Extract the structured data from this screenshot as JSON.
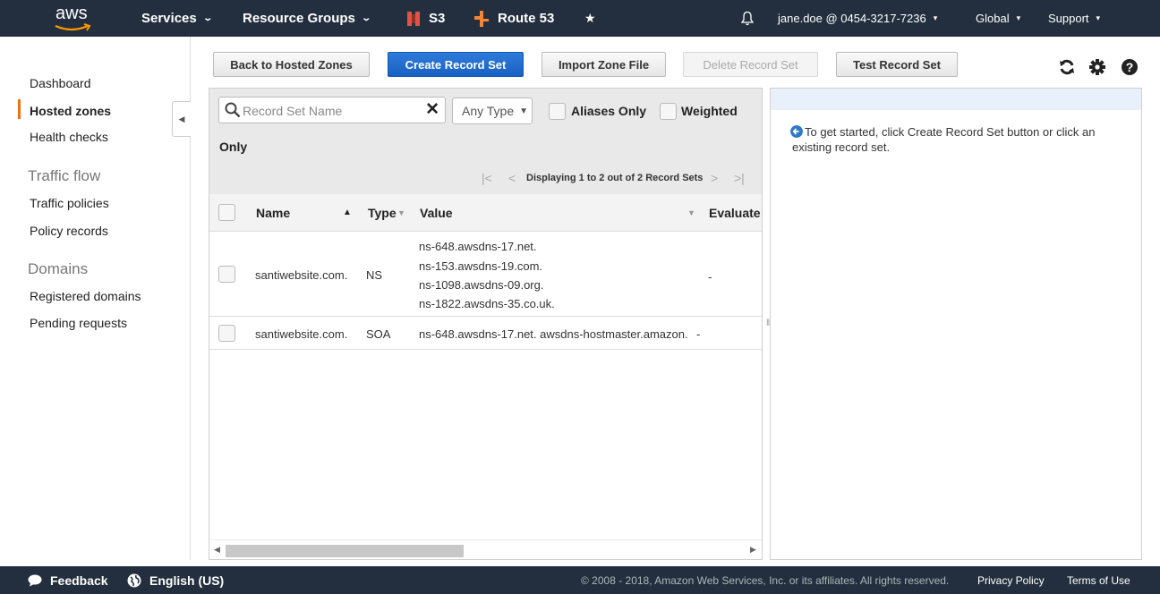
{
  "topnav": {
    "logo": "aws",
    "services": "Services",
    "resource_groups": "Resource Groups",
    "s3": "S3",
    "route53": "Route 53",
    "account": "jane.doe @ 0454-3217-7236",
    "region": "Global",
    "support": "Support",
    "icons": [
      "s3-icon",
      "route53-icon",
      "pin-icon",
      "bell-icon"
    ]
  },
  "sidebar": {
    "items": [
      {
        "label": "Dashboard"
      },
      {
        "label": "Hosted zones",
        "active": true
      },
      {
        "label": "Health checks"
      }
    ],
    "traffic_flow": {
      "heading": "Traffic flow",
      "items": [
        {
          "label": "Traffic policies"
        },
        {
          "label": "Policy records"
        }
      ]
    },
    "domains": {
      "heading": "Domains",
      "items": [
        {
          "label": "Registered domains"
        },
        {
          "label": "Pending requests"
        }
      ]
    },
    "accent_color": "#ec7211"
  },
  "toolbar": {
    "back": "Back to Hosted Zones",
    "create": "Create Record Set",
    "import": "Import Zone File",
    "delete": "Delete Record Set",
    "test": "Test Record Set",
    "icons": [
      "refresh-icon",
      "gear-icon",
      "help-icon"
    ]
  },
  "filters": {
    "search_placeholder": "Record Set Name",
    "type_select": "Any Type",
    "aliases_only": "Aliases Only",
    "weighted": "Weighted",
    "weighted_only": "Only",
    "pager_text": "Displaying 1 to 2 out of 2 Record Sets"
  },
  "table": {
    "columns": [
      "Name",
      "Type",
      "Value",
      "Evaluate"
    ],
    "rows": [
      {
        "name": "santiwebsite.com.",
        "type": "NS",
        "value": [
          "ns-648.awsdns-17.net.",
          "ns-153.awsdns-19.com.",
          "ns-1098.awsdns-09.org.",
          "ns-1822.awsdns-35.co.uk."
        ],
        "evaluate": "-"
      },
      {
        "name": "santiwebsite.com.",
        "type": "SOA",
        "value": [
          "ns-648.awsdns-17.net. awsdns-hostmaster.amazon."
        ],
        "evaluate": "-"
      }
    ]
  },
  "details": {
    "message": "To get started, click Create Record Set button or click an existing record set."
  },
  "footer": {
    "feedback": "Feedback",
    "language": "English (US)",
    "copyright": "© 2008 - 2018, Amazon Web Services, Inc. or its affiliates. All rights reserved.",
    "privacy": "Privacy Policy",
    "terms": "Terms of Use"
  },
  "colors": {
    "nav_bg": "#232f3e",
    "primary_button": "#1f6bcf"
  }
}
